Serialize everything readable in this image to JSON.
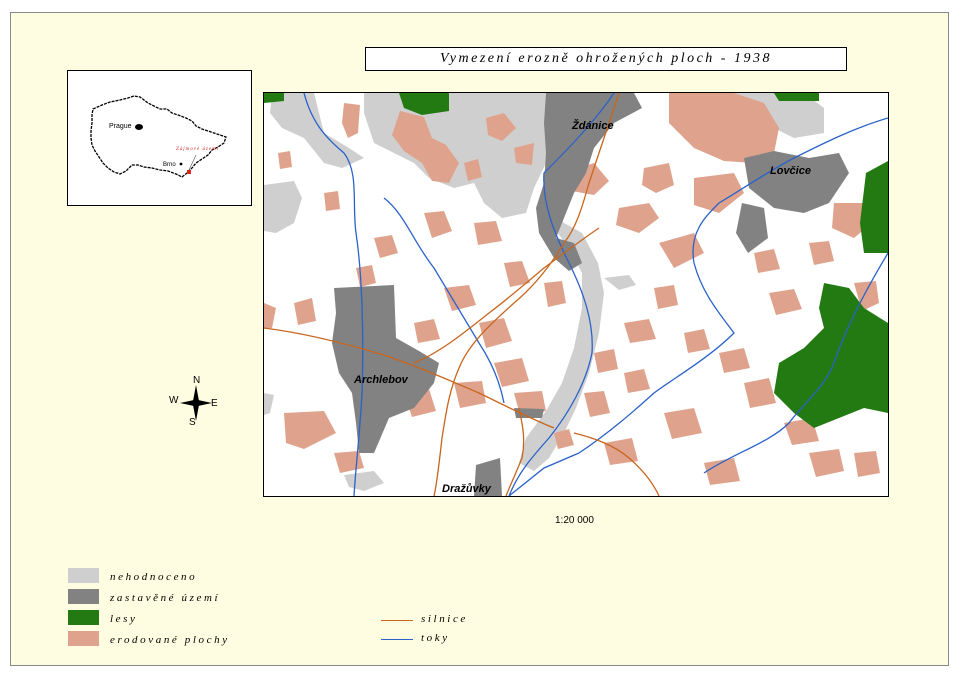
{
  "title": "Vymezení erozně ohrožených ploch - 1938",
  "inset": {
    "city_prague": "Prague",
    "city_brno": "Brno",
    "area_label": "Zájmové území"
  },
  "places": {
    "zdanice": "Ždánice",
    "lovcice": "Lovčice",
    "archlebov": "Archlebov",
    "drazuvky": "Dražůvky"
  },
  "compass": {
    "n": "N",
    "s": "S",
    "e": "E",
    "w": "W"
  },
  "scale": "1:20 000",
  "legend": {
    "areas": [
      {
        "label": "nehodnoceno",
        "color": "#cfcfcf"
      },
      {
        "label": "zastavěné území",
        "color": "#828282"
      },
      {
        "label": "lesy",
        "color": "#237a12"
      },
      {
        "label": "erodované plochy",
        "color": "#dfa38d"
      }
    ],
    "lines": [
      {
        "label": "silnice",
        "color": "#c8651d"
      },
      {
        "label": "toky",
        "color": "#2a62c9"
      }
    ]
  },
  "colors": {
    "background": "#fffde1",
    "unevaluated": "#cfcfcf",
    "built_up": "#828282",
    "forest": "#237a12",
    "eroded": "#dfa38d",
    "road": "#c8651d",
    "stream": "#2a62c9"
  }
}
